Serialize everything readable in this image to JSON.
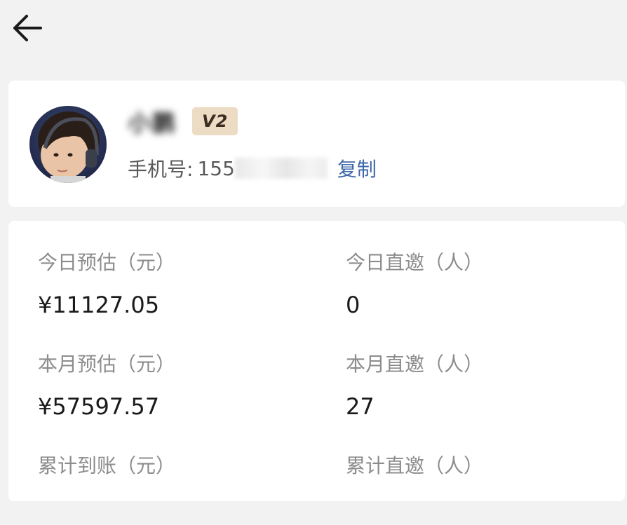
{
  "header": {
    "back_icon": "arrow-left-icon"
  },
  "profile": {
    "username": "小鹏",
    "level_badge": "V2",
    "phone_label": "手机号:",
    "phone_visible": "155",
    "copy_label": "复制",
    "avatar_icon": "avatar-photo"
  },
  "stats": [
    {
      "label": "今日预估（元）",
      "value": "¥11127.05"
    },
    {
      "label": "今日直邀（人）",
      "value": "0"
    },
    {
      "label": "本月预估（元）",
      "value": "¥57597.57"
    },
    {
      "label": "本月直邀（人）",
      "value": "27"
    },
    {
      "label": "累计到账（元）",
      "value": ""
    },
    {
      "label": "累计直邀（人）",
      "value": ""
    }
  ],
  "colors": {
    "background": "#f2f2f2",
    "card": "#ffffff",
    "badge_bg": "#ecdcc4",
    "link": "#3d67a8",
    "label": "#8c8c8c"
  }
}
